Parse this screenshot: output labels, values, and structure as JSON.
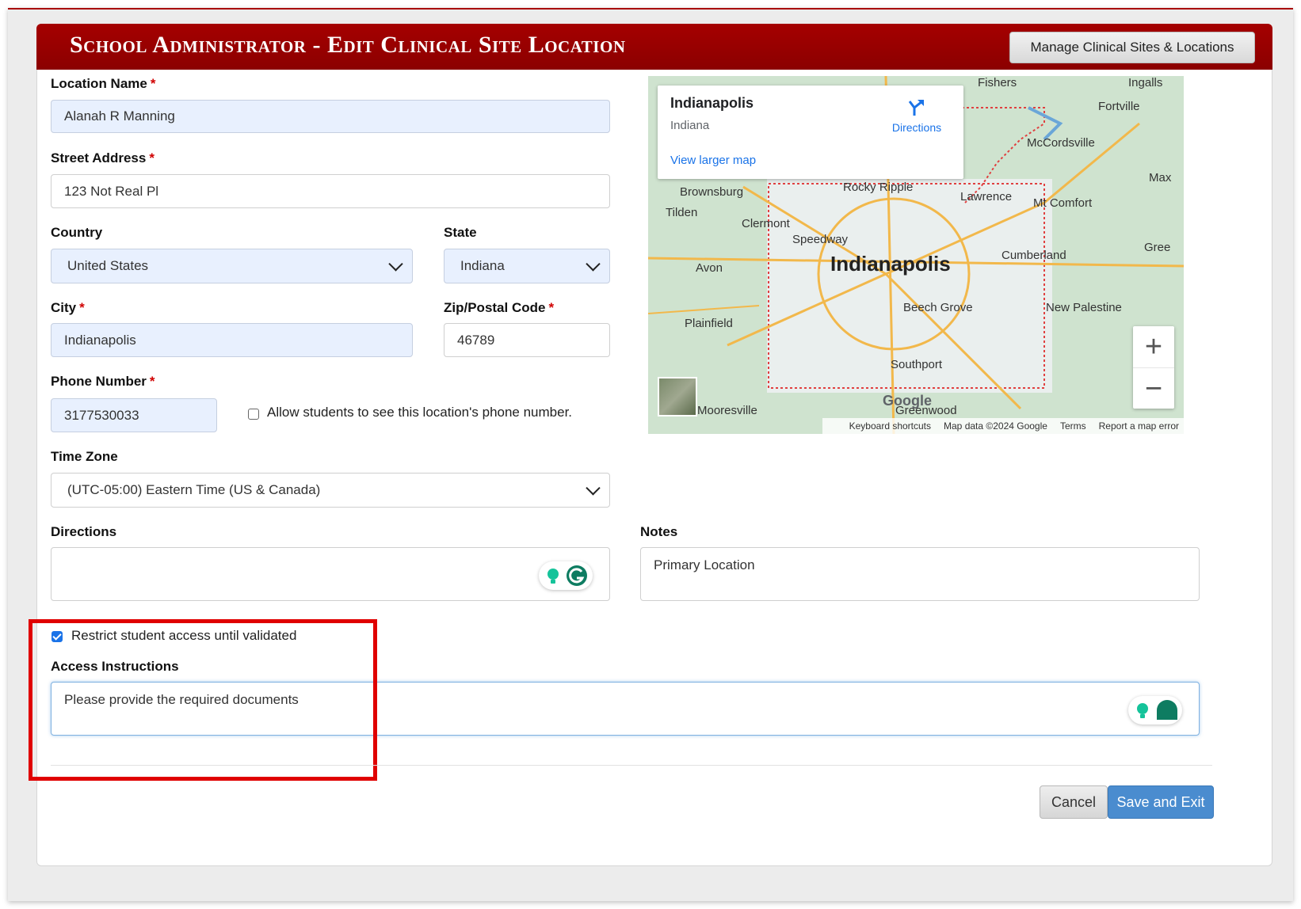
{
  "header": {
    "title": "School Administrator - Edit Clinical Site Location",
    "manage_button": "Manage Clinical Sites & Locations"
  },
  "form": {
    "location_name": {
      "label": "Location Name",
      "value": "Alanah R Manning"
    },
    "street_address": {
      "label": "Street Address",
      "value": "123 Not Real Pl"
    },
    "country": {
      "label": "Country",
      "value": "United States"
    },
    "state": {
      "label": "State",
      "value": "Indiana"
    },
    "city": {
      "label": "City",
      "value": "Indianapolis"
    },
    "zip": {
      "label": "Zip/Postal Code",
      "value": "46789"
    },
    "phone": {
      "label": "Phone Number",
      "value": "3177530033",
      "show_label": "Allow students to see this location's phone number.",
      "show_checked": false
    },
    "time_zone": {
      "label": "Time Zone",
      "value": "(UTC-05:00) Eastern Time (US & Canada)"
    },
    "directions": {
      "label": "Directions",
      "value": ""
    },
    "notes": {
      "label": "Notes",
      "value": "Primary Location"
    },
    "restrict": {
      "label": "Restrict student access until validated",
      "checked": true
    },
    "access_instructions": {
      "label": "Access Instructions",
      "value": "Please provide the required documents"
    },
    "required_marker": "*"
  },
  "map": {
    "place_title": "Indianapolis",
    "place_subtitle": "Indiana",
    "directions_link": "Directions",
    "larger_map_link": "View larger map",
    "city_label": "Indianapolis",
    "labels": [
      "Fishers",
      "Ingalls",
      "Fortville",
      "McCordsville",
      "Brownsburg",
      "Rocky Ripple",
      "Lawrence",
      "Mt Comfort",
      "Tilden",
      "Clermont",
      "Speedway",
      "Cumberland",
      "Avon",
      "Beech Grove",
      "New Palestine",
      "Plainfield",
      "Southport",
      "Mooresville",
      "Greenwood",
      "Max",
      "Gree"
    ],
    "google": "Google",
    "footer": [
      "Keyboard shortcuts",
      "Map data ©2024 Google",
      "Terms",
      "Report a map error"
    ],
    "zoom_in": "+",
    "zoom_out": "−"
  },
  "actions": {
    "cancel": "Cancel",
    "save": "Save and Exit"
  },
  "colors": {
    "header": "#a50000",
    "highlight": "#e00000",
    "primary_button": "#4a8ccf",
    "autofill": "#e8f0fe"
  }
}
